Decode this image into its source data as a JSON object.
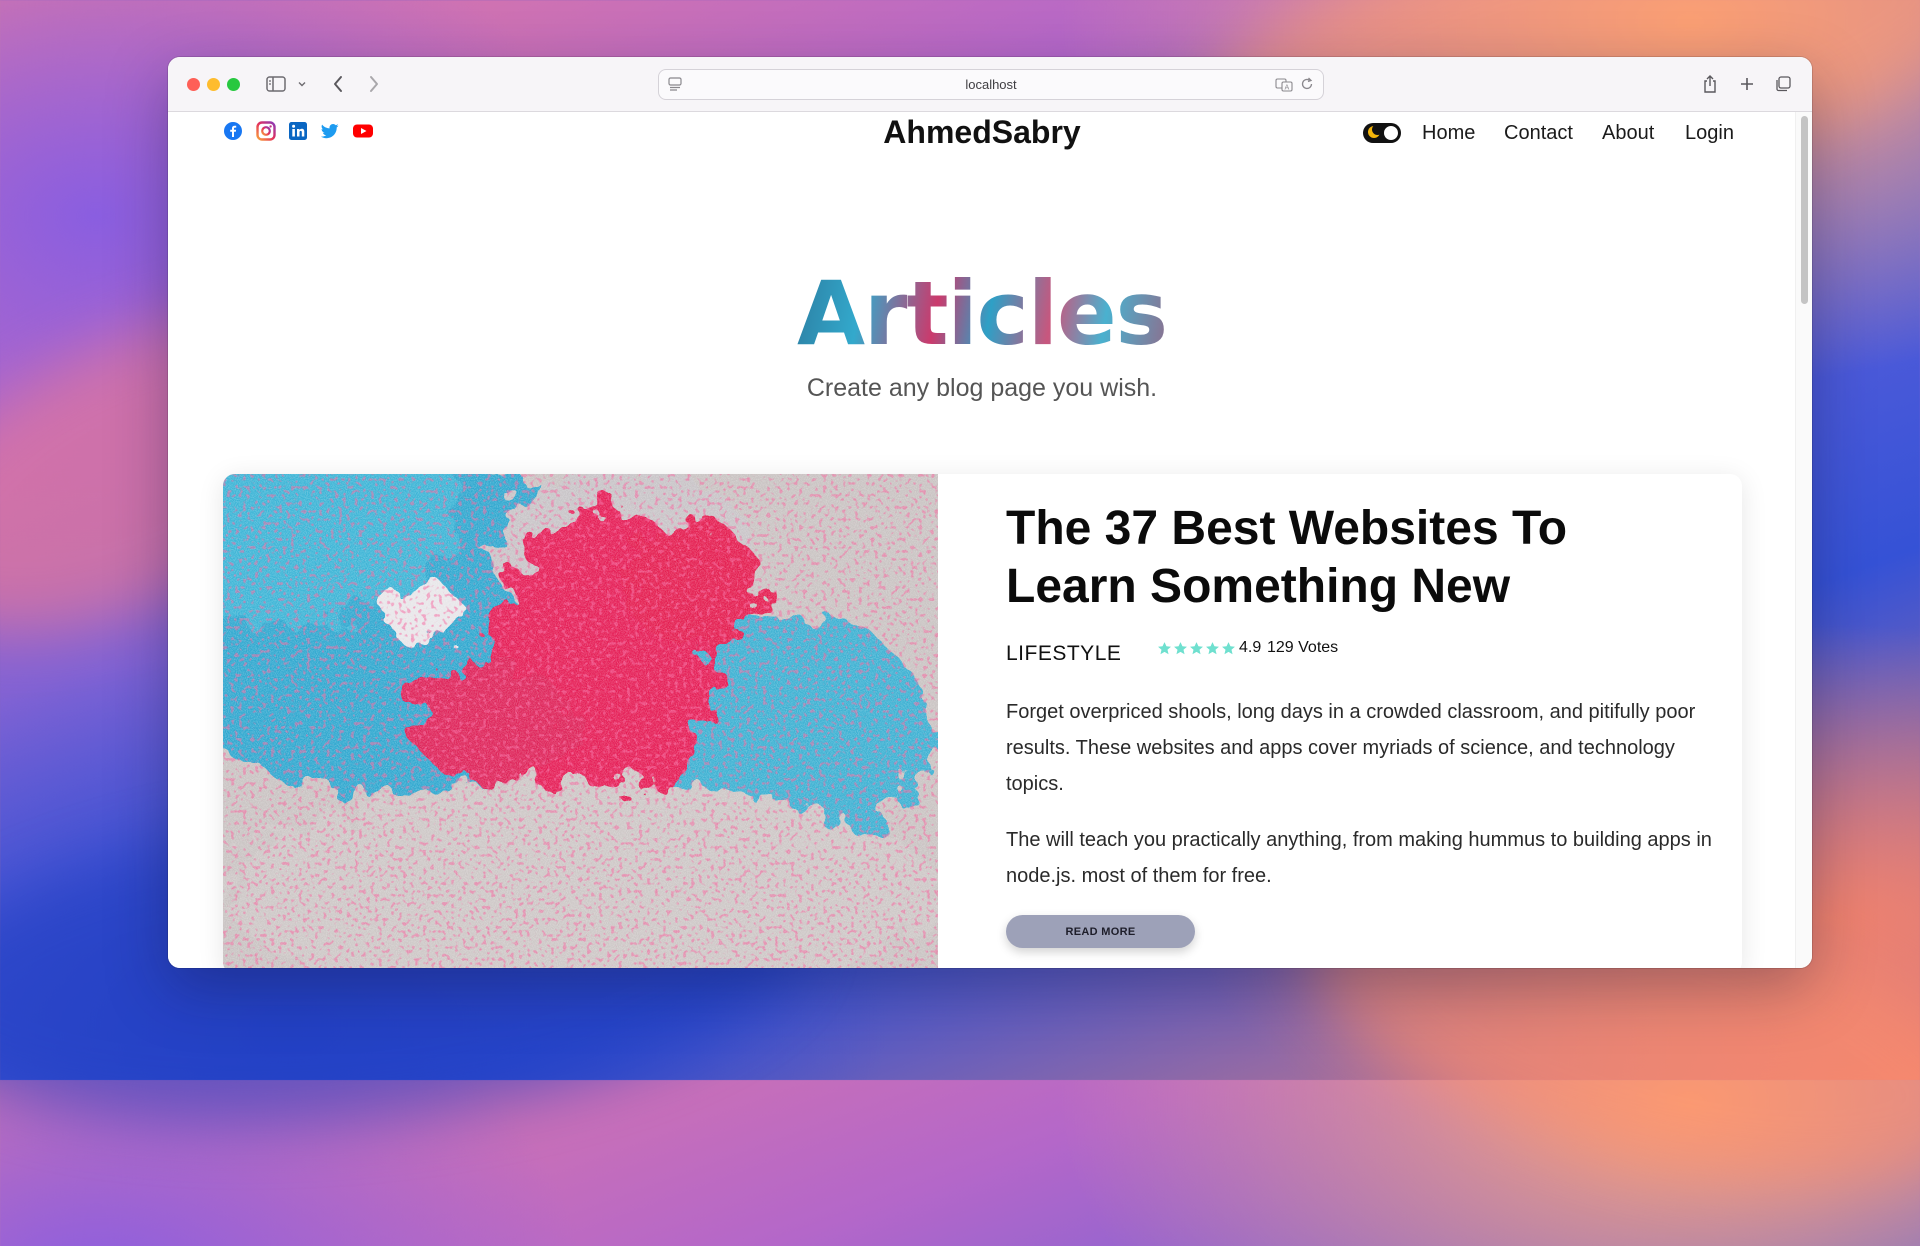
{
  "browser": {
    "url": "localhost"
  },
  "site": {
    "brand": "AhmedSabry",
    "social_icons": [
      "facebook-icon",
      "instagram-icon",
      "linkedin-icon",
      "twitter-icon",
      "youtube-icon"
    ],
    "nav": {
      "home": "Home",
      "contact": "Contact",
      "about": "About",
      "login": "Login"
    }
  },
  "hero": {
    "title": "Articles",
    "subtitle": "Create any blog page you wish."
  },
  "article": {
    "title": "The 37 Best Websites To Learn Something New",
    "category": "LIFESTYLE",
    "rating": "4.9",
    "rating_stars": 5,
    "votes": "129 Votes",
    "paragraph_1": "Forget overpriced shools, long days in a crowded classroom, and pitifully poor results. These websites and apps cover myriads of science, and technology topics.",
    "paragraph_2": "The will teach you practically anything, from making hummus to building apps in node.js. most of them for free.",
    "read_more": "READ MORE"
  },
  "colors": {
    "star": "#6fe0cf",
    "button": "#9da1b8",
    "facebook": "#1877f2",
    "youtube": "#ff0000",
    "linkedin": "#0a66c2",
    "twitter": "#1d9bf0"
  }
}
